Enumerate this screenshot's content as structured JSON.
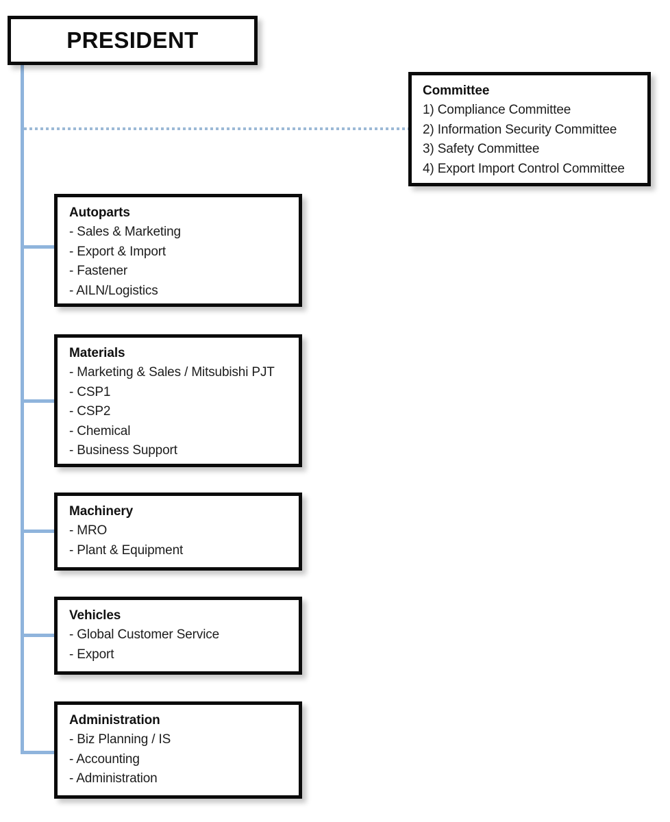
{
  "root": {
    "label": "PRESIDENT"
  },
  "committee": {
    "title": "Committee",
    "items": [
      "1) Compliance Committee",
      "2) Information Security Committee",
      "3) Safety Committee",
      "4) Export Import Control Committee"
    ]
  },
  "departments": [
    {
      "title": "Autoparts",
      "items": [
        "- Sales & Marketing",
        "- Export & Import",
        "- Fastener",
        "- AILN/Logistics"
      ]
    },
    {
      "title": "Materials",
      "items": [
        "- Marketing & Sales / Mitsubishi PJT",
        "- CSP1",
        "- CSP2",
        "- Chemical",
        "- Business Support"
      ]
    },
    {
      "title": "Machinery",
      "items": [
        "- MRO",
        "- Plant & Equipment"
      ]
    },
    {
      "title": "Vehicles",
      "items": [
        "- Global Customer Service",
        "- Export"
      ]
    },
    {
      "title": "Administration",
      "items": [
        "- Biz Planning / IS",
        "- Accounting",
        "- Administration"
      ]
    }
  ],
  "style": {
    "connector_color": "#8FB4DC",
    "dotted_connector_color": "#9CB9D6",
    "box_border_color": "#0B0B0B",
    "box_fill_color": "#FFFFFF",
    "text_color": "#1A1A1A"
  }
}
